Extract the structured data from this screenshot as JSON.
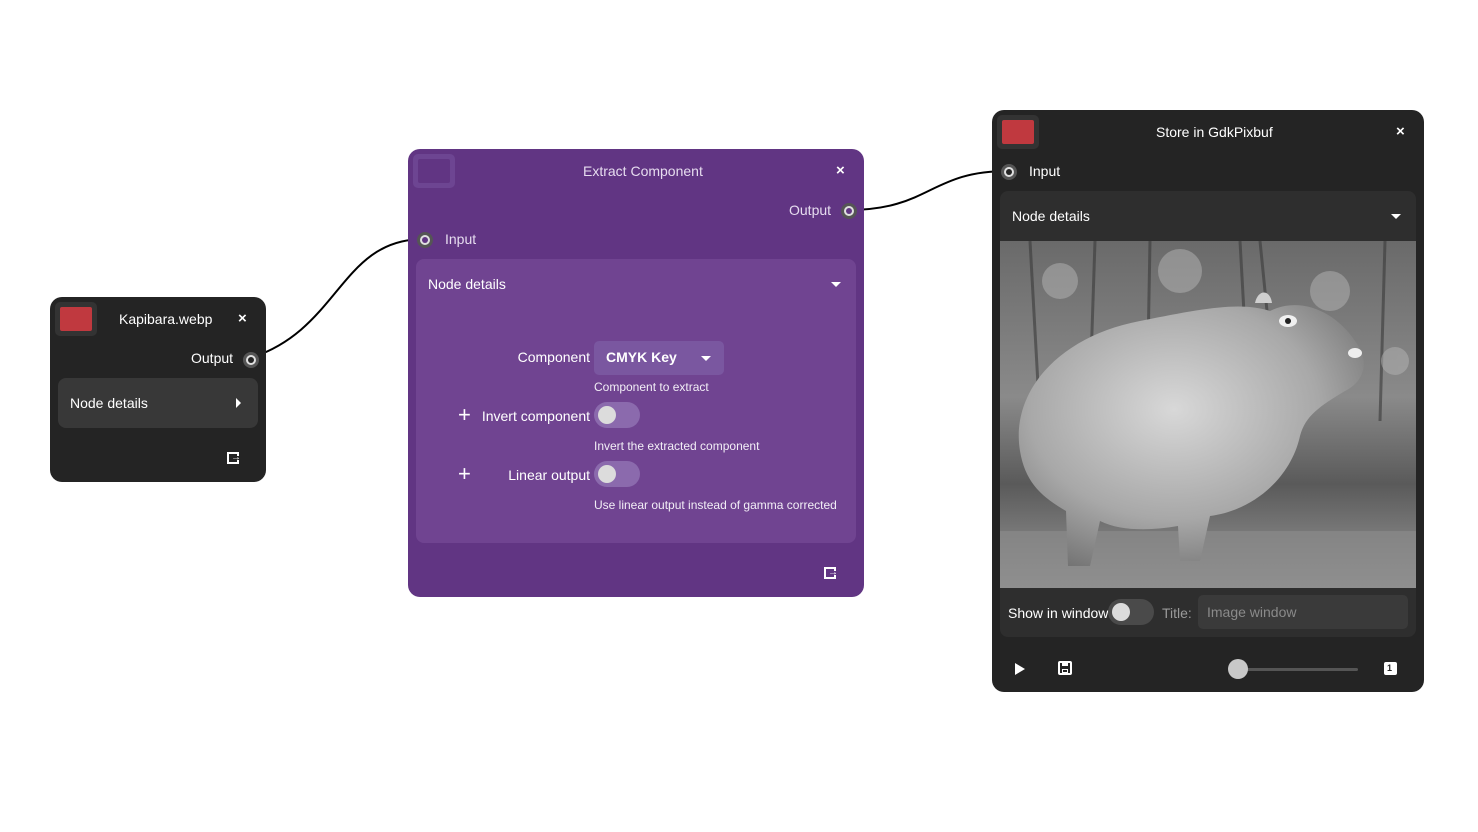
{
  "colors": {
    "dark_node": "#242424",
    "purple_node": "#613583",
    "image_node_swatch": "#c0393f",
    "purple_swatch": "#6d4592"
  },
  "nodes": {
    "kapibara": {
      "title": "Kapibara.webp",
      "close": "×",
      "output_label": "Output",
      "details_label": "Node details",
      "export_icon": "export-icon"
    },
    "extract": {
      "title": "Extract Component",
      "close": "×",
      "output_label": "Output",
      "input_label": "Input",
      "details_label": "Node details",
      "properties": {
        "component": {
          "label": "Component",
          "value": "CMYK Key",
          "help": "Component to extract"
        },
        "invert": {
          "label": "Invert component",
          "help": "Invert the extracted component",
          "enabled": false
        },
        "linear": {
          "label": "Linear output",
          "help": "Use linear output instead of gamma corrected",
          "enabled": false
        }
      },
      "export_icon": "export-icon"
    },
    "store": {
      "title": "Store in GdkPixbuf",
      "close": "×",
      "input_label": "Input",
      "details_label": "Node details",
      "show_in_window_label": "Show in window",
      "show_in_window_enabled": false,
      "title_label": "Title:",
      "title_placeholder": "Image window",
      "zoom_badge": "1",
      "slider_level": 0.0
    }
  }
}
